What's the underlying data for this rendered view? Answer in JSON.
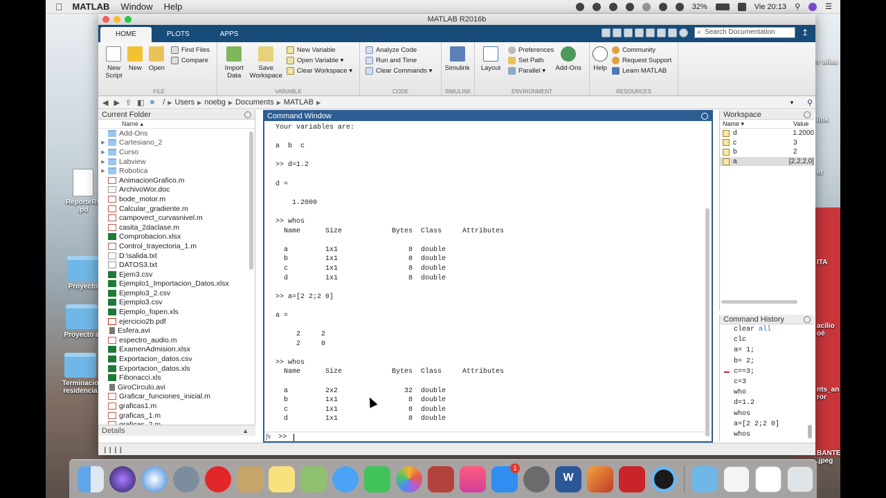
{
  "menubar": {
    "app": "MATLAB",
    "menus": [
      "Window",
      "Help"
    ],
    "battery": "32%",
    "clock": "Vie 20:13"
  },
  "window": {
    "title": "MATLAB R2016b"
  },
  "ribbon": {
    "tabs": [
      "HOME",
      "PLOTS",
      "APPS"
    ],
    "search_placeholder": "Search Documentation",
    "sections": {
      "file": {
        "label": "FILE",
        "new_script": "New\nScript",
        "new": "New",
        "open": "Open",
        "find_files": "Find Files",
        "compare": "Compare"
      },
      "variable": {
        "label": "VARIABLE",
        "import_data": "Import\nData",
        "save_workspace": "Save\nWorkspace",
        "new_variable": "New Variable",
        "open_variable": "Open Variable",
        "clear_workspace": "Clear Workspace"
      },
      "code": {
        "label": "CODE",
        "analyze_code": "Analyze Code",
        "run_and_time": "Run and Time",
        "clear_commands": "Clear Commands"
      },
      "simulink": {
        "label": "SIMULINK",
        "simulink": "Simulink"
      },
      "environment": {
        "label": "ENVIRONMENT",
        "layout": "Layout",
        "preferences": "Preferences",
        "set_path": "Set Path",
        "parallel": "Parallel",
        "add_ons": "Add-Ons"
      },
      "resources": {
        "label": "RESOURCES",
        "help": "Help",
        "community": "Community",
        "request_support": "Request Support",
        "learn_matlab": "Learn MATLAB"
      }
    }
  },
  "address": {
    "root": "/",
    "crumbs": [
      "Users",
      "noebg",
      "Documents",
      "MATLAB"
    ]
  },
  "current_folder": {
    "title": "Current Folder",
    "col_name": "Name ▴",
    "details": "Details",
    "items": [
      {
        "name": "Add-Ons",
        "type": "folder",
        "expand": ""
      },
      {
        "name": "Cartesiano_2",
        "type": "folder",
        "expand": "▶"
      },
      {
        "name": "Curso",
        "type": "folder",
        "expand": "▶"
      },
      {
        "name": "Labview",
        "type": "folder",
        "expand": "▶"
      },
      {
        "name": "Robotica",
        "type": "folder",
        "expand": "▶"
      },
      {
        "name": "AnimacionGrafico.m",
        "type": "mfile",
        "expand": ""
      },
      {
        "name": "ArchivoWor.doc",
        "type": "txt",
        "expand": ""
      },
      {
        "name": "bode_motor.m",
        "type": "mfile",
        "expand": ""
      },
      {
        "name": "Calcular_gradiente.m",
        "type": "mfile",
        "expand": ""
      },
      {
        "name": "campovect_curvasnivel.m",
        "type": "mfile",
        "expand": ""
      },
      {
        "name": "casita_2daclase.m",
        "type": "mfile",
        "expand": ""
      },
      {
        "name": "Comprobacion.xlsx",
        "type": "xls",
        "expand": ""
      },
      {
        "name": "Control_trayectoria_1.m",
        "type": "mfile",
        "expand": ""
      },
      {
        "name": "D:\\salida.txt",
        "type": "txt",
        "expand": ""
      },
      {
        "name": "DATOS3.txt",
        "type": "txt",
        "expand": ""
      },
      {
        "name": "Ejem3.csv",
        "type": "xls",
        "expand": ""
      },
      {
        "name": "Ejemplo1_Importacion_Datos.xlsx",
        "type": "xls",
        "expand": ""
      },
      {
        "name": "Ejemplo3_2.csv",
        "type": "xls",
        "expand": ""
      },
      {
        "name": "Ejemplo3.csv",
        "type": "xls",
        "expand": ""
      },
      {
        "name": "Ejemplo_fopen.xls",
        "type": "xls",
        "expand": ""
      },
      {
        "name": "ejercicio2b.pdf",
        "type": "pdf",
        "expand": ""
      },
      {
        "name": "Esfera.avi",
        "type": "avi",
        "expand": ""
      },
      {
        "name": "espectro_audio.m",
        "type": "mfile",
        "expand": ""
      },
      {
        "name": "ExamenAdmision.xlsx",
        "type": "xls",
        "expand": ""
      },
      {
        "name": "Exportacion_datos.csv",
        "type": "xls",
        "expand": ""
      },
      {
        "name": "Exportacion_datos.xls",
        "type": "xls",
        "expand": ""
      },
      {
        "name": "Fibonacci.xls",
        "type": "xls",
        "expand": ""
      },
      {
        "name": "GiroCirculo.avi",
        "type": "avi",
        "expand": ""
      },
      {
        "name": "Graficar_funciones_inicial.m",
        "type": "mfile",
        "expand": ""
      },
      {
        "name": "graficas1.m",
        "type": "mfile",
        "expand": ""
      },
      {
        "name": "graficas_1.m",
        "type": "mfile",
        "expand": ""
      },
      {
        "name": "graficas_2.m",
        "type": "mfile",
        "expand": ""
      }
    ]
  },
  "command_window": {
    "title": "Command Window",
    "lines": [
      "Your variables are:",
      "",
      "a  b  c",
      "",
      ">> d=1.2",
      "",
      "d =",
      "",
      "    1.2000",
      "",
      ">> whos",
      "  Name      Size            Bytes  Class     Attributes",
      "",
      "  a         1x1                 8  double",
      "  b         1x1                 8  double",
      "  c         1x1                 8  double",
      "  d         1x1                 8  double",
      "",
      ">> a=[2 2;2 0]",
      "",
      "a =",
      "",
      "     2     2",
      "     2     0",
      "",
      ">> whos",
      "  Name      Size            Bytes  Class     Attributes",
      "",
      "  a         2x2                32  double",
      "  b         1x1                 8  double",
      "  c         1x1                 8  double",
      "  d         1x1                 8  double"
    ],
    "fx": "fx",
    "prompt": ">>"
  },
  "workspace": {
    "title": "Workspace",
    "col_name": "Name ▾",
    "col_value": "Value",
    "rows": [
      {
        "name": "d",
        "value": "1.2000"
      },
      {
        "name": "c",
        "value": "3"
      },
      {
        "name": "b",
        "value": "2"
      },
      {
        "name": "a",
        "value": "[2,2;2,0]"
      }
    ]
  },
  "history": {
    "title": "Command History",
    "rows": [
      {
        "cmd": "clear ",
        "kw": "all"
      },
      {
        "cmd": "clc",
        "kw": ""
      },
      {
        "cmd": "a= 1;",
        "kw": ""
      },
      {
        "cmd": "b= 2;",
        "kw": ""
      },
      {
        "cmd": "c==3;",
        "kw": ""
      },
      {
        "cmd": "c=3",
        "kw": ""
      },
      {
        "cmd": "who",
        "kw": ""
      },
      {
        "cmd": "d=1.2",
        "kw": ""
      },
      {
        "cmd": "whos",
        "kw": ""
      },
      {
        "cmd": "a=[2 2;2 0]",
        "kw": ""
      },
      {
        "cmd": "whos",
        "kw": ""
      }
    ]
  },
  "desktop": {
    "labels": [
      "ReporteRe",
      ".pd",
      "Proyecto",
      "Proyecto a",
      "Terminacio",
      "residencia",
      "er alias",
      "link",
      "et",
      "ITA",
      "acilio",
      "oé",
      "nts_an",
      "ror",
      "BANTE",
      ".jpeg"
    ]
  },
  "dock": {
    "mail_badge": "1",
    "appstore_badge": "1"
  }
}
